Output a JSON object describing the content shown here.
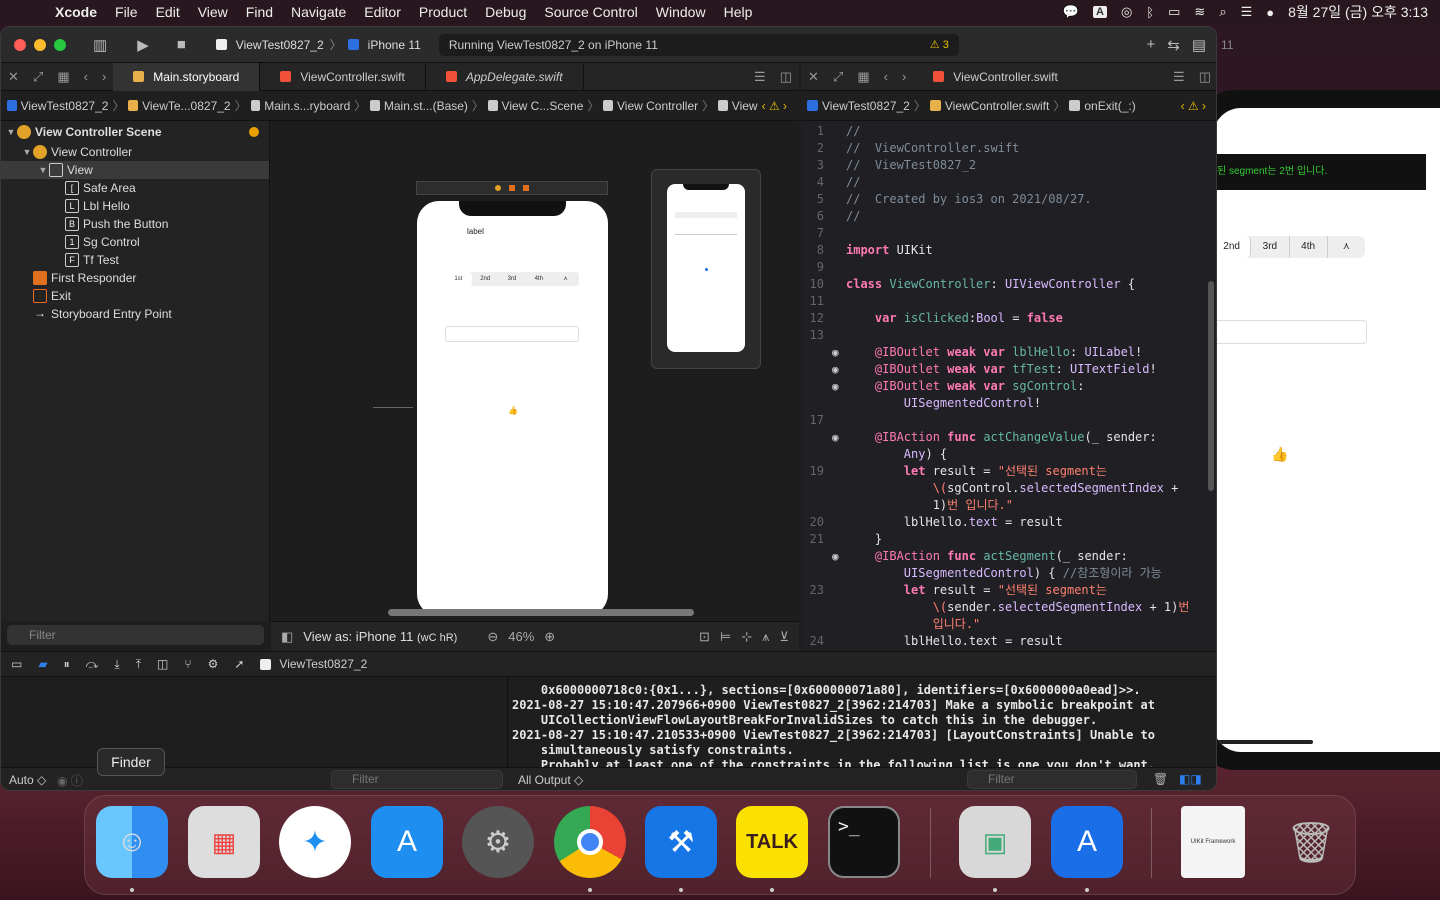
{
  "menubar": {
    "app": "Xcode",
    "items": [
      "File",
      "Edit",
      "View",
      "Find",
      "Navigate",
      "Editor",
      "Product",
      "Debug",
      "Source Control",
      "Window",
      "Help"
    ],
    "input_indicator": "A",
    "datetime": "8월 27일 (금) 오후 3:13"
  },
  "toolbar": {
    "scheme": "ViewTest0827_2",
    "device": "iPhone 11",
    "status": "Running ViewTest0827_2 on iPhone 11",
    "warning_count": "3"
  },
  "left_tabs": [
    {
      "label": "Main.storyboard",
      "active": true
    },
    {
      "label": "ViewController.swift",
      "active": false
    },
    {
      "label": "AppDelegate.swift",
      "active": false
    }
  ],
  "left_jump": [
    "ViewTest0827_2",
    "ViewTe...0827_2",
    "Main.s...ryboard",
    "Main.st...(Base)",
    "View C...Scene",
    "View Controller",
    "View"
  ],
  "outline": {
    "scene": "View Controller Scene",
    "rows": [
      {
        "label": "View Controller",
        "indent": 1,
        "icon": "Y"
      },
      {
        "label": "View",
        "indent": 2,
        "icon": ""
      },
      {
        "label": "Safe Area",
        "indent": 3,
        "icon": "[]"
      },
      {
        "label": "Lbl Hello",
        "indent": 3,
        "icon": "L"
      },
      {
        "label": "Push the Button",
        "indent": 3,
        "icon": "B"
      },
      {
        "label": "Sg Control",
        "indent": 3,
        "icon": "1 2"
      },
      {
        "label": "Tf Test",
        "indent": 3,
        "icon": "F"
      },
      {
        "label": "First Responder",
        "indent": 1,
        "icon": "FR"
      },
      {
        "label": "Exit",
        "indent": 1,
        "icon": "EX"
      },
      {
        "label": "Storyboard Entry Point",
        "indent": 1,
        "icon": "→"
      }
    ],
    "filter_placeholder": "Filter"
  },
  "canvas": {
    "label_text": "label",
    "segments": [
      "1st",
      "2nd",
      "3rd",
      "4th"
    ],
    "view_as": "View as: iPhone 11",
    "size_class": "(wC hR)",
    "zoom": "46%"
  },
  "right_tab": "ViewController.swift",
  "right_jump": [
    "ViewTest0827_2",
    "ViewController.swift",
    "onExit(_:)"
  ],
  "code_lines": [
    {
      "n": "1",
      "g": "",
      "h": "<span class='cm'>//</span>"
    },
    {
      "n": "2",
      "g": "",
      "h": "<span class='cm'>//  ViewController.swift</span>"
    },
    {
      "n": "3",
      "g": "",
      "h": "<span class='cm'>//  ViewTest0827_2</span>"
    },
    {
      "n": "4",
      "g": "",
      "h": "<span class='cm'>//</span>"
    },
    {
      "n": "5",
      "g": "",
      "h": "<span class='cm'>//  Created by ios3 on 2021/08/27.</span>"
    },
    {
      "n": "6",
      "g": "",
      "h": "<span class='cm'>//</span>"
    },
    {
      "n": "7",
      "g": "",
      "h": ""
    },
    {
      "n": "8",
      "g": "",
      "h": "<span class='kw'>import</span> UIKit"
    },
    {
      "n": "9",
      "g": "",
      "h": ""
    },
    {
      "n": "10",
      "g": "",
      "h": "<span class='kw'>class</span> <span class='fn'>ViewController</span>: <span class='ty'>UIViewController</span> {"
    },
    {
      "n": "11",
      "g": "",
      "h": ""
    },
    {
      "n": "12",
      "g": "",
      "h": "    <span class='kw'>var</span> <span class='fn'>isClicked</span>:<span class='ty'>Bool</span> = <span class='kw'>false</span>"
    },
    {
      "n": "13",
      "g": "",
      "h": ""
    },
    {
      "n": "",
      "g": "◉",
      "h": "    <span class='at'>@IBOutlet</span> <span class='kw'>weak var</span> <span class='fn'>lblHello</span>: <span class='ty'>UILabel</span>!"
    },
    {
      "n": "",
      "g": "◉",
      "h": "    <span class='at'>@IBOutlet</span> <span class='kw'>weak var</span> <span class='fn'>tfTest</span>: <span class='ty'>UITextField</span>!"
    },
    {
      "n": "",
      "g": "◉",
      "h": "    <span class='at'>@IBOutlet</span> <span class='kw'>weak var</span> <span class='fn'>sgControl</span>:"
    },
    {
      "n": "",
      "g": "",
      "h": "        <span class='ty'>UISegmentedControl</span>!"
    },
    {
      "n": "17",
      "g": "",
      "h": ""
    },
    {
      "n": "",
      "g": "◉",
      "h": "    <span class='at'>@IBAction</span> <span class='kw'>func</span> <span class='fn'>actChangeValue</span>(_ sender:"
    },
    {
      "n": "",
      "g": "",
      "h": "        <span class='ty'>Any</span>) {"
    },
    {
      "n": "19",
      "g": "",
      "h": "        <span class='kw'>let</span> result = <span class='st'>\"선택된 segment는</span>"
    },
    {
      "n": "",
      "g": "",
      "h": "            <span class='st'>\\(</span>sgControl.<span class='ty'>selectedSegmentIndex</span> +"
    },
    {
      "n": "",
      "g": "",
      "h": "            1)<span class='st'>번 입니다.\"</span>"
    },
    {
      "n": "20",
      "g": "",
      "h": "        lblHello.<span class='ty'>text</span> = result"
    },
    {
      "n": "21",
      "g": "",
      "h": "    }"
    },
    {
      "n": "",
      "g": "◉",
      "h": "    <span class='at'>@IBAction</span> <span class='kw'>func</span> <span class='fn'>actSegment</span>(_ sender:"
    },
    {
      "n": "",
      "g": "",
      "h": "        <span class='ty'>UISegmentedControl</span>) { <span class='cm'>//참조형이라 가능</span>"
    },
    {
      "n": "23",
      "g": "",
      "h": "        <span class='kw'>let</span> result = <span class='st'>\"선택된 segment는</span>"
    },
    {
      "n": "",
      "g": "",
      "h": "            <span class='st'>\\(</span>sender.<span class='ty'>selectedSegmentIndex</span> + 1)<span class='st'>번</span>"
    },
    {
      "n": "",
      "g": "",
      "h": "            <span class='st'>입니다.\"</span>"
    },
    {
      "n": "24",
      "g": "",
      "h": "        lblHello.text = result"
    }
  ],
  "debug": {
    "target": "ViewTest0827_2",
    "console": [
      "    0x6000000718c0:{0x1...}, sections=[0x600000071a80], identifiers=[0x6000000a0ead]>>.",
      "2021-08-27 15:10:47.207966+0900 ViewTest0827_2[3962:214703] Make a symbolic breakpoint at",
      "    UICollectionViewFlowLayoutBreakForInvalidSizes to catch this in the debugger.",
      "2021-08-27 15:10:47.210533+0900 ViewTest0827_2[3962:214703] [LayoutConstraints] Unable to",
      "    simultaneously satisfy constraints.",
      "    Probably at least one of the constraints in the following list is one you don't want."
    ],
    "auto_label": "Auto ◇",
    "filter_placeholder": "Filter",
    "output_label": "All Output ◇"
  },
  "simulator": {
    "title": "e 11",
    "label_text": "된 segment는 2번 입니다.",
    "segments": [
      "2nd",
      "3rd",
      "4th",
      "⋏"
    ]
  },
  "dock": {
    "tooltip": "Finder",
    "talk_label": "TALK",
    "terminal_label": ">_",
    "folder_label": "UIKit Framework"
  },
  "colors": {
    "accent": "#1a6ee8",
    "warning": "#e8c000",
    "red": "#ff5f57",
    "yellow": "#febc2e",
    "green": "#28c840"
  }
}
